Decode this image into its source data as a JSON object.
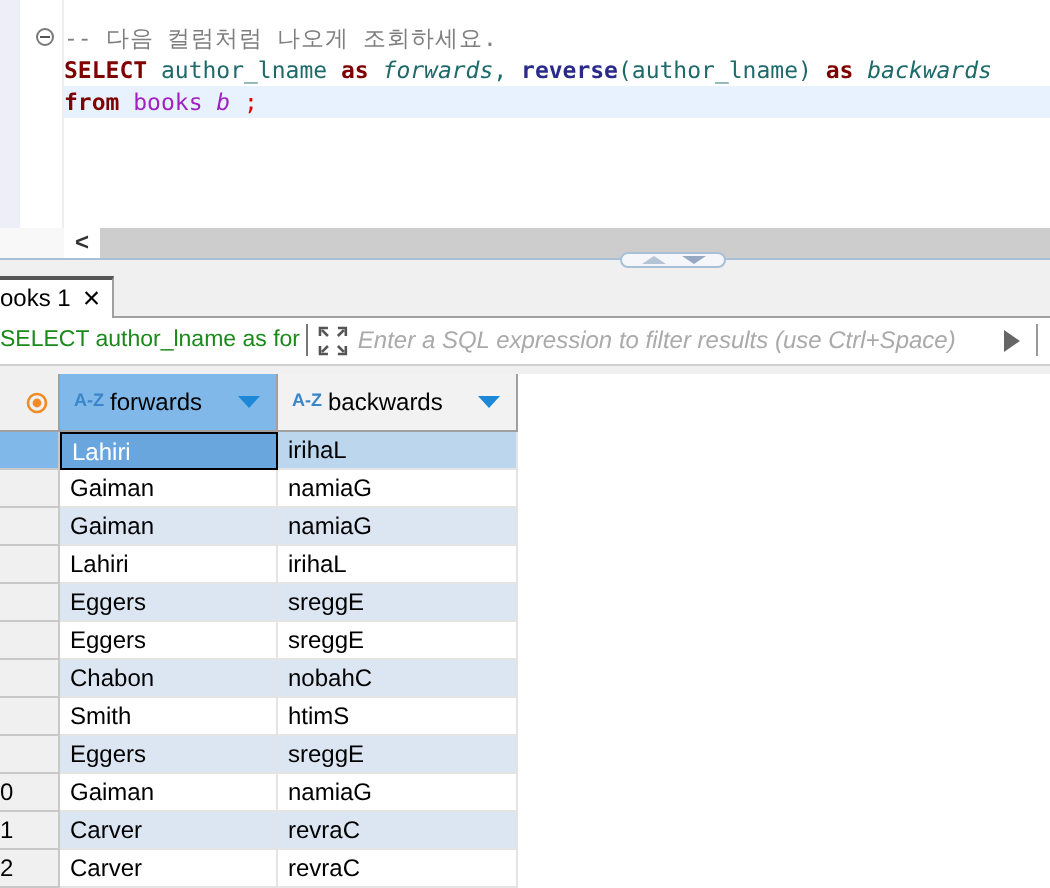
{
  "editor": {
    "lines": [
      {
        "fold": true,
        "current": false,
        "tokens": [
          {
            "kind": "comment",
            "text": "-- 다음 컬럼처럼 나오게 조회하세요."
          }
        ]
      },
      {
        "fold": false,
        "current": false,
        "tokens": [
          {
            "kind": "keyword",
            "text": "SELECT"
          },
          {
            "kind": "plain",
            "text": " author_lname "
          },
          {
            "kind": "keyword",
            "text": "as"
          },
          {
            "kind": "alias",
            "text": " forwards"
          },
          {
            "kind": "plain",
            "text": ", "
          },
          {
            "kind": "function",
            "text": "reverse"
          },
          {
            "kind": "plain",
            "text": "(author_lname) "
          },
          {
            "kind": "keyword",
            "text": "as"
          },
          {
            "kind": "alias",
            "text": " backwards"
          }
        ]
      },
      {
        "fold": false,
        "current": true,
        "tokens": [
          {
            "kind": "keyword",
            "text": "from"
          },
          {
            "kind": "table",
            "text": " books"
          },
          {
            "kind": "tablealias",
            "text": " b"
          },
          {
            "kind": "punct",
            "text": " ;"
          }
        ]
      }
    ],
    "scroll_left": "<"
  },
  "results": {
    "tab": {
      "label": "ooks 1",
      "close": "×"
    },
    "query": "SELECT author_lname as for",
    "filter": {
      "placeholder": "Enter a SQL expression to filter results (use Ctrl+Space)"
    },
    "columns": [
      {
        "type_label": "A-Z",
        "label": "forwards",
        "selected": true
      },
      {
        "type_label": "A-Z",
        "label": "backwards",
        "selected": false
      }
    ],
    "rows": [
      {
        "num": "",
        "selected": true,
        "cells": [
          "Lahiri",
          "irihaL"
        ]
      },
      {
        "num": "",
        "selected": false,
        "cells": [
          "Gaiman",
          "namiaG"
        ]
      },
      {
        "num": "",
        "selected": false,
        "cells": [
          "Gaiman",
          "namiaG"
        ]
      },
      {
        "num": "",
        "selected": false,
        "cells": [
          "Lahiri",
          "irihaL"
        ]
      },
      {
        "num": "",
        "selected": false,
        "cells": [
          "Eggers",
          "sreggE"
        ]
      },
      {
        "num": "",
        "selected": false,
        "cells": [
          "Eggers",
          "sreggE"
        ]
      },
      {
        "num": "",
        "selected": false,
        "cells": [
          "Chabon",
          "nobahC"
        ]
      },
      {
        "num": "",
        "selected": false,
        "cells": [
          "Smith",
          "htimS"
        ]
      },
      {
        "num": "",
        "selected": false,
        "cells": [
          "Eggers",
          "sreggE"
        ]
      },
      {
        "num": "0",
        "selected": false,
        "cells": [
          "Gaiman",
          "namiaG"
        ]
      },
      {
        "num": "1",
        "selected": false,
        "cells": [
          "Carver",
          "revraC"
        ]
      },
      {
        "num": "2",
        "selected": false,
        "cells": [
          "Carver",
          "revraC"
        ]
      }
    ]
  }
}
